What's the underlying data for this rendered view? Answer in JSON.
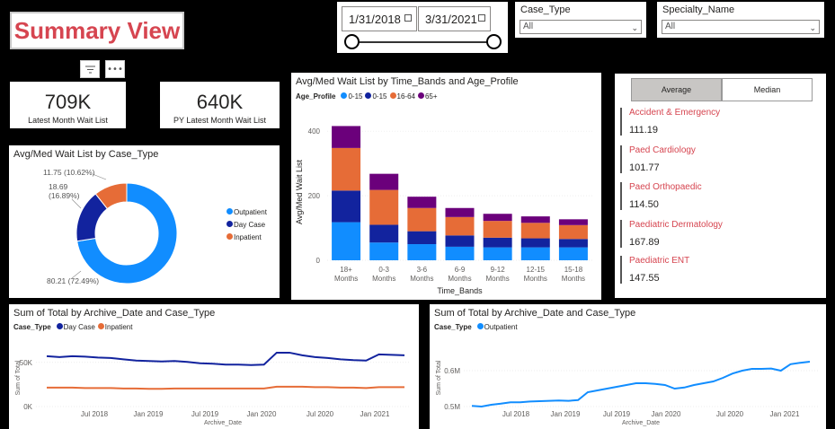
{
  "page_title": "Summary View",
  "date_filter": {
    "start": "1/31/2018",
    "end": "3/31/2021"
  },
  "case_type_filter": {
    "label": "Case_Type",
    "value": "All"
  },
  "specialty_filter": {
    "label": "Specialty_Name",
    "value": "All"
  },
  "kpis": [
    {
      "value": "709K",
      "label": "Latest Month Wait List"
    },
    {
      "value": "640K",
      "label": "PY Latest Month Wait List"
    }
  ],
  "toggle": {
    "average": "Average",
    "median": "Median",
    "selected": "Average"
  },
  "specialties": [
    {
      "name": "Accident & Emergency",
      "value": "111.19"
    },
    {
      "name": "Paed Cardiology",
      "value": "101.77"
    },
    {
      "name": "Paed Orthopaedic",
      "value": "114.50"
    },
    {
      "name": "Paediatric Dermatology",
      "value": "167.89"
    },
    {
      "name": "Paediatric ENT",
      "value": "147.55"
    }
  ],
  "colors": {
    "outpatient": "#118dff",
    "daycase": "#12239e",
    "inpatient": "#e66c37",
    "age65": "#6b007b",
    "accent": "#d64550"
  },
  "chart_data": [
    {
      "type": "pie",
      "title": "Avg/Med Wait List by Case_Type",
      "legend": [
        "Outpatient",
        "Day Case",
        "Inpatient"
      ],
      "values": [
        80.21,
        18.69,
        11.75
      ],
      "labels": [
        "80.21 (72.49%)",
        "18.69 (16.89%)",
        "11.75 (10.62%)"
      ]
    },
    {
      "type": "bar",
      "title": "Avg/Med Wait List by Time_Bands and Age_Profile",
      "legend_title": "Age_Profile",
      "xlabel": "Time_Bands",
      "ylabel": "Avg/Med Wait List",
      "ylim": [
        0,
        420
      ],
      "yticks": [
        0,
        200,
        400
      ],
      "categories": [
        "18+ Months",
        "0-3 Months",
        "3-6 Months",
        "6-9 Months",
        "9-12 Months",
        "12-15 Months",
        "15-18 Months"
      ],
      "series": [
        {
          "name": "0-15",
          "values": [
            118,
            55,
            50,
            42,
            40,
            40,
            40
          ]
        },
        {
          "name": "0-15",
          "values": [
            98,
            55,
            40,
            35,
            30,
            28,
            26
          ]
        },
        {
          "name": "16-64",
          "values": [
            132,
            108,
            72,
            57,
            52,
            48,
            43
          ]
        },
        {
          "name": "65+",
          "values": [
            68,
            50,
            35,
            28,
            22,
            20,
            18
          ]
        }
      ]
    },
    {
      "type": "line",
      "title": "Sum of Total by Archive_Date and Case_Type",
      "legend_title": "Case_Type",
      "xlabel": "Archive_Date",
      "ylabel": "Sum of Total",
      "ylim": [
        0,
        65000
      ],
      "yticks": [
        "0K",
        "50K"
      ],
      "xticks": [
        "Jul 2018",
        "Jan 2019",
        "Jul 2019",
        "Jan 2020",
        "Jul 2020",
        "Jan 2021"
      ],
      "series": [
        {
          "name": "Day Case",
          "values": [
            57000,
            56000,
            57000,
            56500,
            55500,
            55000,
            53500,
            52000,
            51500,
            51000,
            51500,
            50500,
            49000,
            48500,
            47500,
            47500,
            47000,
            47500,
            61000,
            61000,
            58000,
            56000,
            55000,
            53500,
            52500,
            52000,
            59000,
            58500,
            58000
          ]
        },
        {
          "name": "Inpatient",
          "values": [
            21500,
            21500,
            21500,
            21000,
            21000,
            21000,
            20500,
            20500,
            20000,
            20000,
            20500,
            20500,
            20500,
            20500,
            20500,
            20500,
            20500,
            20500,
            22500,
            22500,
            22500,
            22000,
            22000,
            21500,
            21500,
            21000,
            22000,
            22000,
            22000
          ]
        }
      ]
    },
    {
      "type": "line",
      "title": "Sum of Total by Archive_Date and Case_Type",
      "legend_title": "Case_Type",
      "xlabel": "Archive_Date",
      "ylabel": "Sum of Total",
      "ylim": [
        0.5,
        0.66
      ],
      "yticks": [
        "0.5M",
        "0.6M"
      ],
      "xticks": [
        "Jul 2018",
        "Jan 2019",
        "Jul 2019",
        "Jan 2020",
        "Jul 2020",
        "Jan 2021"
      ],
      "series": [
        {
          "name": "Outpatient",
          "values": [
            0.502,
            0.5,
            0.505,
            0.508,
            0.512,
            0.512,
            0.514,
            0.515,
            0.516,
            0.517,
            0.516,
            0.518,
            0.54,
            0.545,
            0.55,
            0.555,
            0.56,
            0.565,
            0.565,
            0.563,
            0.56,
            0.55,
            0.553,
            0.56,
            0.565,
            0.57,
            0.58,
            0.592,
            0.6,
            0.605,
            0.605,
            0.606,
            0.6,
            0.618,
            0.622,
            0.625
          ]
        }
      ]
    }
  ]
}
